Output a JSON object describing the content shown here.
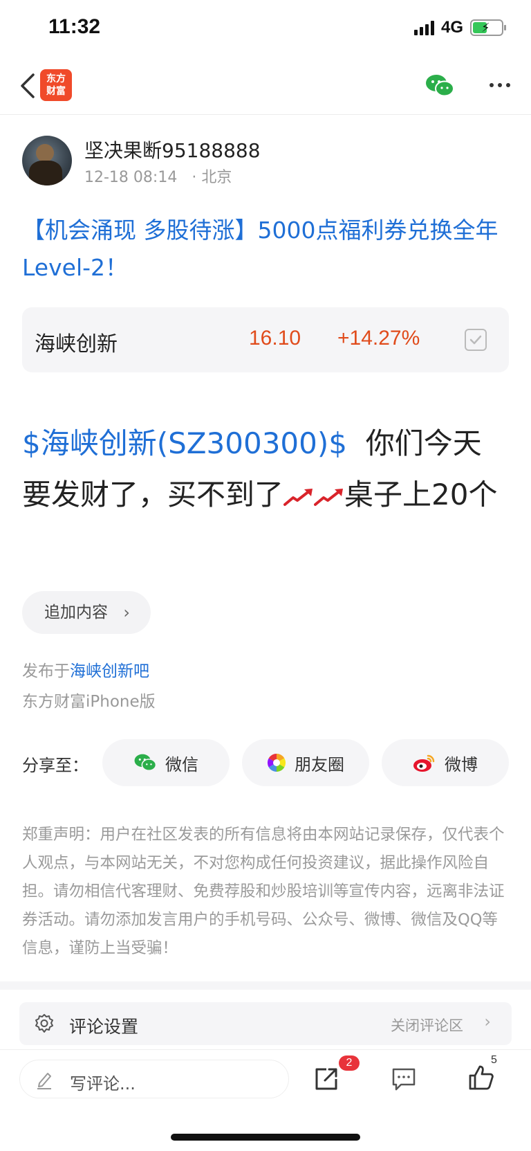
{
  "status_bar": {
    "time": "11:32",
    "network": "4G",
    "battery_level": 0.5
  },
  "nav": {
    "logo_line1": "东方",
    "logo_line2": "财富",
    "back_icon": "chevron-left-icon",
    "share_icon": "wechat-icon",
    "more_icon": "more-icon"
  },
  "author": {
    "name": "坚决果断95188888",
    "date": "12-18 08:14",
    "location": "· 北京"
  },
  "promo_title": "【机会涌现 多股待涨】5000点福利券兑换全年Level-2！",
  "stock": {
    "name": "海峡创新",
    "price": "16.10",
    "change": "+14.27%"
  },
  "post": {
    "stock_link": "$海峡创新(SZ300300)$",
    "text_part1": "你们今天要发财了，买不到了",
    "text_part2": "桌子上20个"
  },
  "add_content": {
    "label": "追加内容"
  },
  "posted_in": {
    "prefix": "发布于",
    "bar": "海峡创新吧"
  },
  "client": "东方财富iPhone版",
  "share": {
    "label": "分享至：",
    "wechat": "微信",
    "moments": "朋友圈",
    "weibo": "微博"
  },
  "disclaimer": "郑重声明：用户在社区发表的所有信息将由本网站记录保存，仅代表个人观点，与本网站无关，不对您构成任何投资建议，据此操作风险自担。请勿相信代客理财、免费荐股和炒股培训等宣传内容，远离非法证券活动。请勿添加发言用户的手机号码、公众号、微博、微信及QQ等信息，谨防上当受骗！",
  "comment_settings": {
    "label": "评论设置",
    "action": "关闭评论区"
  },
  "bottom_bar": {
    "placeholder": "写评论...",
    "share_badge": "2",
    "like_count": "5"
  },
  "colors": {
    "link_blue": "#1f6fd6",
    "rise_red": "#e04b1b",
    "brand_orange": "#f04a2a",
    "badge_red": "#e8333a"
  }
}
